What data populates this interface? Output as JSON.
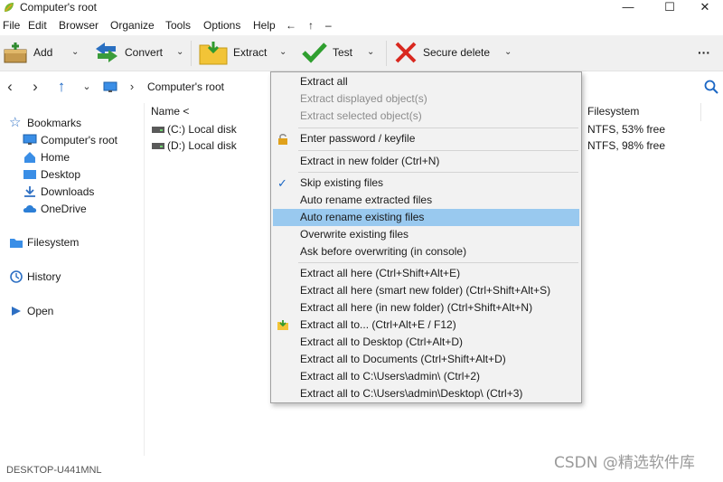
{
  "window": {
    "title": "Computer's root",
    "min_icon": "minimize-icon",
    "max_icon": "maximize-icon",
    "close_icon": "close-icon"
  },
  "menubar": {
    "items": [
      "File",
      "Edit",
      "Browser",
      "Organize",
      "Tools",
      "Options",
      "Help"
    ],
    "extra": [
      "←",
      "↑",
      "–"
    ]
  },
  "toolbar": {
    "add": "Add",
    "convert": "Convert",
    "extract": "Extract",
    "test": "Test",
    "secure_delete": "Secure delete",
    "more": "···"
  },
  "nav": {
    "breadcrumb": "Computer's root"
  },
  "sidebar": {
    "bookmarks": "Bookmarks",
    "computer_root": "Computer's root",
    "home": "Home",
    "desktop": "Desktop",
    "downloads": "Downloads",
    "onedrive": "OneDrive",
    "filesystem": "Filesystem",
    "history": "History",
    "open": "Open"
  },
  "filelist": {
    "col_name": "Name <",
    "col_fs": "Filesystem",
    "rows": [
      {
        "name": "(C:) Local disk",
        "fs": "NTFS, 53% free"
      },
      {
        "name": "(D:) Local disk",
        "fs": "NTFS, 98% free"
      }
    ]
  },
  "dropdown": {
    "items": [
      "Extract all",
      "Extract displayed object(s)",
      "Extract selected object(s)",
      "Enter password / keyfile",
      "Extract in new folder (Ctrl+N)",
      "Skip existing files",
      "Auto rename extracted files",
      "Auto rename existing files",
      "Overwrite existing files",
      "Ask before overwriting (in console)",
      "Extract all here (Ctrl+Shift+Alt+E)",
      "Extract all here (smart new folder) (Ctrl+Shift+Alt+S)",
      "Extract all here (in new folder) (Ctrl+Shift+Alt+N)",
      "Extract all to... (Ctrl+Alt+E / F12)",
      "Extract all to Desktop (Ctrl+Alt+D)",
      "Extract all to Documents (Ctrl+Shift+Alt+D)",
      "Extract all to C:\\Users\\admin\\ (Ctrl+2)",
      "Extract all to C:\\Users\\admin\\Desktop\\ (Ctrl+3)"
    ],
    "check_mark": "✓"
  },
  "status": {
    "host": "DESKTOP-U441MNL",
    "watermark": "CSDN @精选软件库"
  },
  "colors": {
    "highlight": "#99c9ef",
    "accent": "#1a66c4"
  }
}
